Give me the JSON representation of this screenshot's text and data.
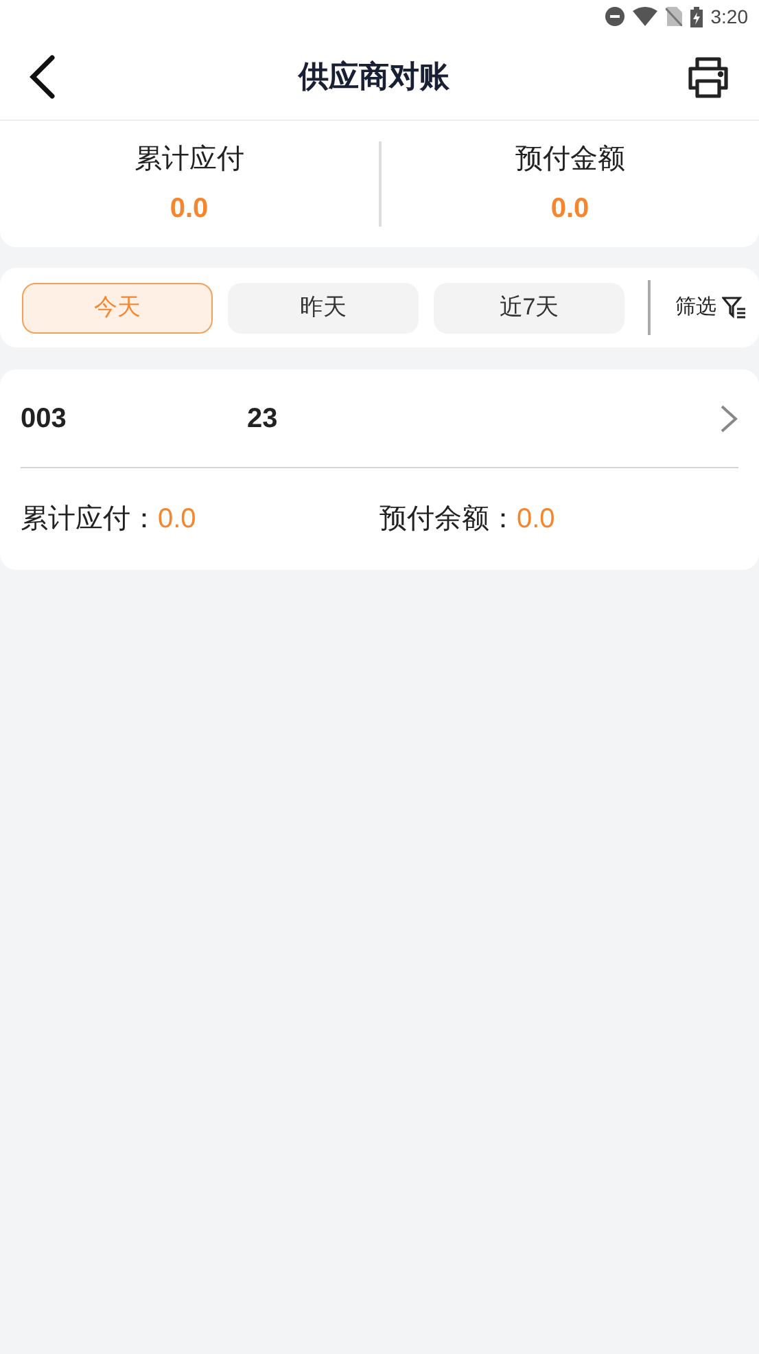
{
  "status_bar": {
    "time": "3:20"
  },
  "header": {
    "title": "供应商对账"
  },
  "summary": [
    {
      "label": "累计应付",
      "value": "0.0"
    },
    {
      "label": "预付金额",
      "value": "0.0"
    }
  ],
  "filters": {
    "tabs": [
      {
        "label": "今天",
        "selected": true
      },
      {
        "label": "昨天",
        "selected": false
      },
      {
        "label": "近7天",
        "selected": false
      }
    ],
    "filter_button": "筛选"
  },
  "records": [
    {
      "code": "003",
      "name": "23",
      "fields": [
        {
          "label": "累计应付：",
          "value": "0.0"
        },
        {
          "label": "预付余额：",
          "value": "0.0"
        }
      ]
    }
  ]
}
